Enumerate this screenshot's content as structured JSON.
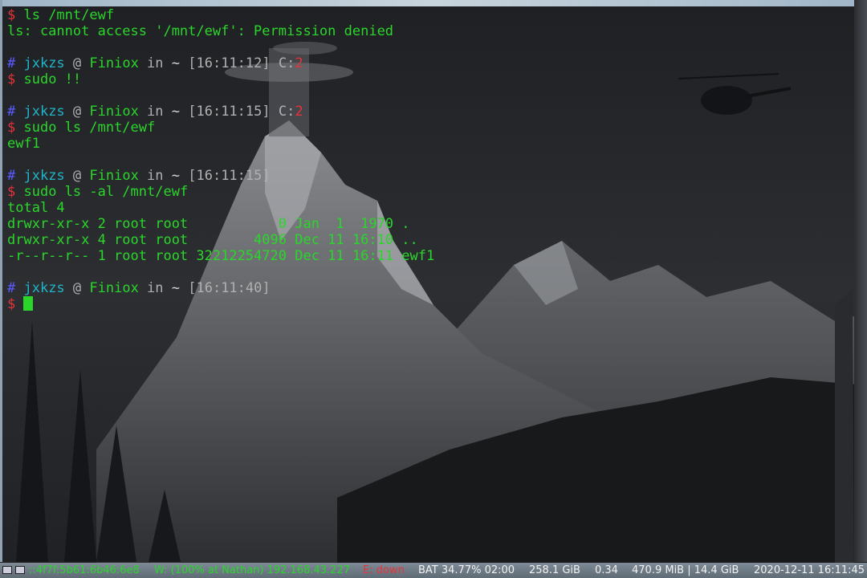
{
  "terminal": {
    "lines": [
      {
        "segments": [
          {
            "text": "$ ",
            "color": "red"
          },
          {
            "text": "ls /mnt/ewf",
            "color": "green"
          }
        ]
      },
      {
        "segments": [
          {
            "text": "ls: cannot access '/mnt/ewf': Permission denied",
            "color": "green"
          }
        ]
      },
      {
        "segments": []
      },
      {
        "segments": [
          {
            "text": "# ",
            "color": "blue"
          },
          {
            "text": "jxkzs",
            "color": "cyan"
          },
          {
            "text": " @ ",
            "color": "grey"
          },
          {
            "text": "Finiox",
            "color": "green"
          },
          {
            "text": " in ",
            "color": "grey"
          },
          {
            "text": "~",
            "color": "white"
          },
          {
            "text": " [16:11:12] C:",
            "color": "grey"
          },
          {
            "text": "2",
            "color": "red"
          }
        ]
      },
      {
        "segments": [
          {
            "text": "$ ",
            "color": "red"
          },
          {
            "text": "sudo !!",
            "color": "green"
          }
        ]
      },
      {
        "segments": []
      },
      {
        "segments": [
          {
            "text": "# ",
            "color": "blue"
          },
          {
            "text": "jxkzs",
            "color": "cyan"
          },
          {
            "text": " @ ",
            "color": "grey"
          },
          {
            "text": "Finiox",
            "color": "green"
          },
          {
            "text": " in ",
            "color": "grey"
          },
          {
            "text": "~",
            "color": "white"
          },
          {
            "text": " [16:11:15] C:",
            "color": "grey"
          },
          {
            "text": "2",
            "color": "red"
          }
        ]
      },
      {
        "segments": [
          {
            "text": "$ ",
            "color": "red"
          },
          {
            "text": "sudo ls /mnt/ewf",
            "color": "green"
          }
        ]
      },
      {
        "segments": [
          {
            "text": "ewf1",
            "color": "green"
          }
        ]
      },
      {
        "segments": []
      },
      {
        "segments": [
          {
            "text": "# ",
            "color": "blue"
          },
          {
            "text": "jxkzs",
            "color": "cyan"
          },
          {
            "text": " @ ",
            "color": "grey"
          },
          {
            "text": "Finiox",
            "color": "green"
          },
          {
            "text": " in ",
            "color": "grey"
          },
          {
            "text": "~",
            "color": "white"
          },
          {
            "text": " [16:11:15]",
            "color": "grey"
          }
        ]
      },
      {
        "segments": [
          {
            "text": "$ ",
            "color": "red"
          },
          {
            "text": "sudo ls -al /mnt/ewf",
            "color": "green"
          }
        ]
      },
      {
        "segments": [
          {
            "text": "total 4",
            "color": "green"
          }
        ]
      },
      {
        "segments": [
          {
            "text": "drwxr-xr-x 2 root root           0 Jan  1  1970 .",
            "color": "green"
          }
        ]
      },
      {
        "segments": [
          {
            "text": "drwxr-xr-x 4 root root        4096 Dec 11 16:10 ..",
            "color": "green"
          }
        ]
      },
      {
        "segments": [
          {
            "text": "-r--r--r-- 1 root root 32212254720 Dec 11 16:11 ewf1",
            "color": "green"
          }
        ]
      },
      {
        "segments": []
      },
      {
        "segments": [
          {
            "text": "# ",
            "color": "blue"
          },
          {
            "text": "jxkzs",
            "color": "cyan"
          },
          {
            "text": " @ ",
            "color": "grey"
          },
          {
            "text": "Finiox",
            "color": "green"
          },
          {
            "text": " in ",
            "color": "grey"
          },
          {
            "text": "~",
            "color": "white"
          },
          {
            "text": " [16:11:40]",
            "color": "grey"
          }
        ]
      },
      {
        "segments": [
          {
            "text": "$ ",
            "color": "red"
          }
        ]
      }
    ],
    "colors": {
      "red": "#e8323a",
      "green": "#2bd62b",
      "cyan": "#21b5c8",
      "blue": "#5b5bff",
      "grey": "#b0b0b0",
      "white": "#d8d8d8"
    }
  },
  "statusbar": {
    "ipv6": "::4f7f:5b61:6b46:6e8",
    "wireless": "W: (100% at Nathan) 192.168.43.227",
    "ethernet": "E: down",
    "battery": "BAT 34.77% 02:00",
    "disk": "258.1 GiB",
    "load": "0.34",
    "memory": "470.9 MiB | 14.4 GiB",
    "datetime": "2020-12-11 16:11:45",
    "colors": {
      "ipv6": "#2bd62b",
      "wireless": "#2bd62b",
      "ethernet": "#e8323a",
      "default": "#f2f2f2"
    }
  }
}
